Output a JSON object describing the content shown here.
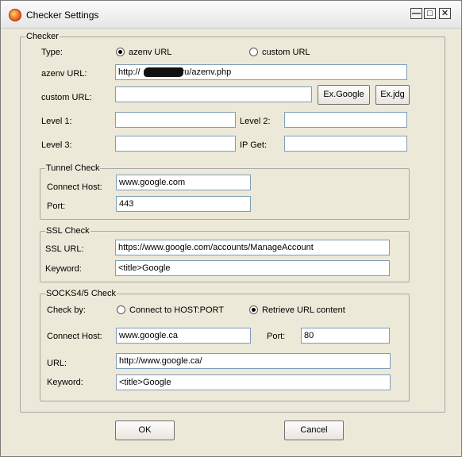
{
  "window": {
    "title": "Checker Settings"
  },
  "checker": {
    "legend": "Checker",
    "type_label": "Type:",
    "radio_azenv": "azenv URL",
    "radio_custom": "custom URL",
    "azenv_label": "azenv URL:",
    "azenv_value": "http://         .h19.ru/azenv.php",
    "custom_label": "custom URL:",
    "custom_value": "",
    "ex_google": "Ex.Google",
    "ex_jdg": "Ex.jdg",
    "level1_label": "Level 1:",
    "level1_value": "",
    "level2_label": "Level 2:",
    "level2_value": "",
    "level3_label": "Level 3:",
    "level3_value": "",
    "ipget_label": "IP Get:",
    "ipget_value": ""
  },
  "tunnel": {
    "legend": "Tunnel Check",
    "host_label": "Connect Host:",
    "host_value": "www.google.com",
    "port_label": "Port:",
    "port_value": "443"
  },
  "ssl": {
    "legend": "SSL Check",
    "url_label": "SSL URL:",
    "url_value": "https://www.google.com/accounts/ManageAccount",
    "keyword_label": "Keyword:",
    "keyword_value": "<title>Google"
  },
  "socks": {
    "legend": "SOCKS4/5 Check",
    "checkby_label": "Check by:",
    "radio_connect": "Connect to HOST:PORT",
    "radio_retrieve": "Retrieve URL content",
    "host_label": "Connect Host:",
    "host_value": "www.google.ca",
    "port_label": "Port:",
    "port_value": "80",
    "url_label": "URL:",
    "url_value": "http://www.google.ca/",
    "keyword_label": "Keyword:",
    "keyword_value": "<title>Google"
  },
  "buttons": {
    "ok": "OK",
    "cancel": "Cancel"
  }
}
